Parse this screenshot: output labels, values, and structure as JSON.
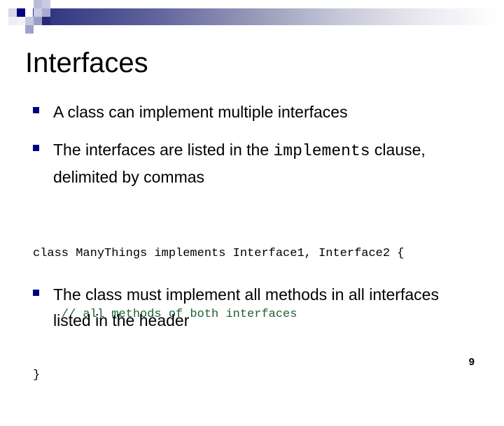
{
  "slide": {
    "title": "Interfaces",
    "page_number": "9",
    "accent_color": "#000080",
    "banner_gradient_from": "#2b2f7d",
    "banner_gradient_to": "#ffffff",
    "comment_color": "#1d6033"
  },
  "bullets": [
    {
      "marker": "square-bullet",
      "text": "A class can implement multiple interfaces"
    },
    {
      "marker": "square-bullet",
      "text_before_code": "The interfaces are listed in the ",
      "code_term": "implements",
      "text_after_code": " clause, delimited by commas"
    },
    {
      "marker": "square-bullet",
      "text": "The class must implement all methods in all interfaces listed in the header"
    }
  ],
  "code_block": {
    "language": "java",
    "lines": [
      {
        "kind": "code",
        "text": "class ManyThings implements Interface1, Interface2 {"
      },
      {
        "kind": "comment",
        "text": "    // all methods of both interfaces"
      },
      {
        "kind": "code",
        "text": "}"
      }
    ]
  }
}
